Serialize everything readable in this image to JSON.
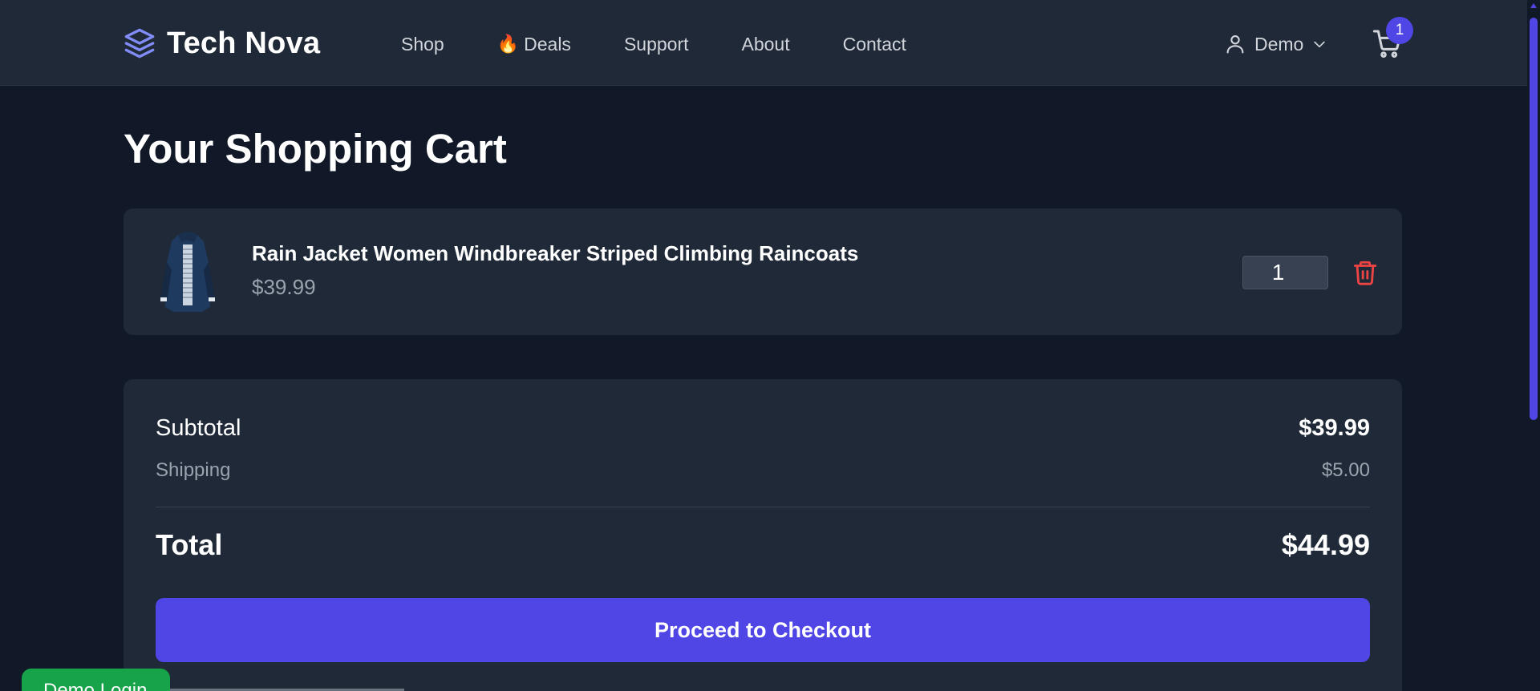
{
  "header": {
    "brand": "Tech Nova",
    "nav": [
      {
        "label": "Shop"
      },
      {
        "label": "Deals",
        "prefix_icon": "🔥"
      },
      {
        "label": "Support"
      },
      {
        "label": "About"
      },
      {
        "label": "Contact"
      }
    ],
    "user": {
      "name": "Demo"
    },
    "cart_count": "1"
  },
  "page": {
    "title": "Your Shopping Cart"
  },
  "cart": {
    "items": [
      {
        "name": "Rain Jacket Women Windbreaker Striped Climbing Raincoats",
        "price": "$39.99",
        "quantity": "1",
        "image_icon": "jacket-image"
      }
    ]
  },
  "summary": {
    "subtotal_label": "Subtotal",
    "subtotal_value": "$39.99",
    "shipping_label": "Shipping",
    "shipping_value": "$5.00",
    "total_label": "Total",
    "total_value": "$44.99",
    "checkout_label": "Proceed to Checkout"
  },
  "floating": {
    "demo_login_label": "Demo Login"
  },
  "colors": {
    "background": "#111827",
    "card": "#1f2937",
    "accent": "#4f46e5",
    "danger": "#ef4444",
    "success": "#16a34a"
  }
}
